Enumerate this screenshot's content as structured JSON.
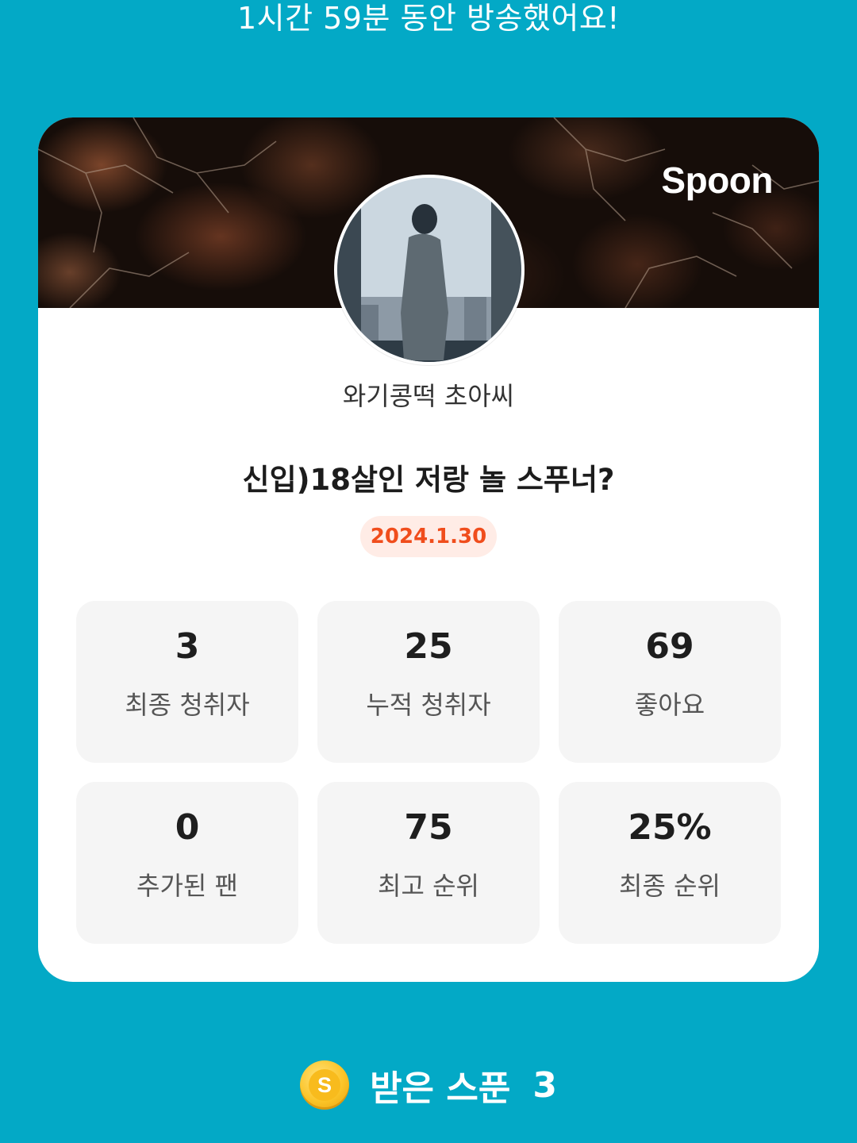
{
  "headline": "1시간 59분 동안 방송했어요!",
  "card": {
    "brand": "Spoon",
    "username": "와기콩떡 초아씨",
    "live_title": "신입)18살인 저랑 놀 스푸너?",
    "date": "2024.1.30",
    "stats": [
      {
        "value": "3",
        "label": "최종 청취자"
      },
      {
        "value": "25",
        "label": "누적 청취자"
      },
      {
        "value": "69",
        "label": "좋아요"
      },
      {
        "value": "0",
        "label": "추가된 팬"
      },
      {
        "value": "75",
        "label": "최고 순위"
      },
      {
        "value": "25%",
        "label": "최종 순위"
      }
    ]
  },
  "spoons": {
    "coin_letter": "S",
    "label": "받은 스푼",
    "count": "3"
  },
  "icons": {
    "coin": "spoon-coin-icon"
  },
  "colors": {
    "background": "#03a9c6",
    "card": "#ffffff",
    "date_text": "#f04d1c",
    "date_bg": "#ffece6",
    "stat_tile": "#f5f5f5"
  }
}
